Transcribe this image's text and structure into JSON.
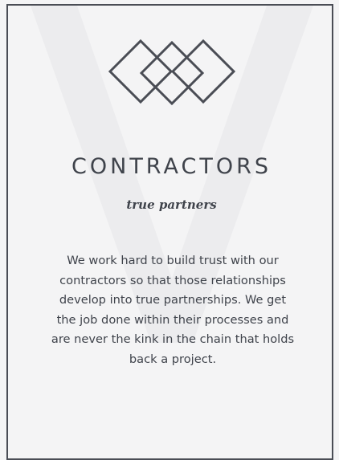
{
  "card": {
    "title": "CONTRACTORS",
    "subtitle": "true partners",
    "description": "We work hard to build trust with our contractors so that those relationships develop into true partnerships. We get the job done within their processes and are never the kink in the chain that holds back a project.",
    "icon": "three-diamonds-logo-icon",
    "watermark": "v-watermark",
    "colors": {
      "text": "#3f434b",
      "border": "#4a4d55",
      "background": "#f4f4f5"
    }
  }
}
